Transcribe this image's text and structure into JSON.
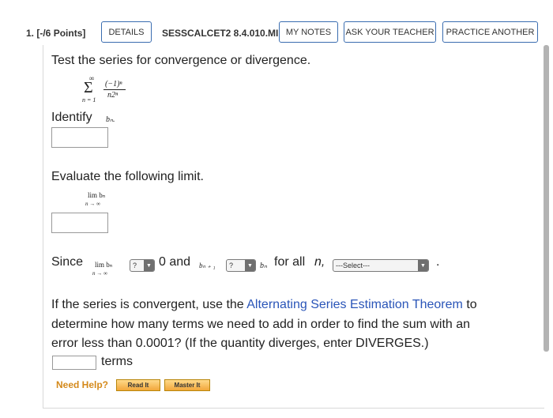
{
  "header": {
    "question_number": "1.",
    "points": "[-/6 Points]",
    "details_label": "DETAILS",
    "question_id": "SESSCALCET2 8.4.010.MI.",
    "my_notes_label": "MY NOTES",
    "ask_teacher_label": "ASK YOUR TEACHER",
    "practice_another_label": "PRACTICE ANOTHER"
  },
  "problem": {
    "prompt": "Test the series for convergence or divergence.",
    "series": {
      "upper": "∞",
      "sigma": "Σ",
      "numerator": "(−1)ⁿ",
      "denominator": "n2ⁿ",
      "lower": "n = 1"
    },
    "identify_label": "Identify",
    "identify_math": "bₙ.",
    "evaluate_label": "Evaluate the following limit.",
    "limit_top": "lim  bₙ",
    "limit_bottom": "n → ∞"
  },
  "since_line": {
    "since": "Since",
    "lim_top": "lim  bₙ",
    "lim_bottom": "n → ∞",
    "select1_value": "?",
    "zero_and": "0 and",
    "b_next": "bₙ ₊ ₁",
    "select2_value": "?",
    "b_n": "bₙ",
    "for_all": "for all",
    "n_var": "n,",
    "select3_value": "---Select---",
    "period": "."
  },
  "estimation": {
    "text_before": "If the series is convergent, use the",
    "link_text": "Alternating Series Estimation Theorem",
    "text_after": "to",
    "line2": "determine how many terms we need to add in order to find the sum with an",
    "line3": "error less than 0.0001? (If the quantity diverges, enter DIVERGES.)",
    "terms_label": "terms"
  },
  "help": {
    "need_help": "Need Help?",
    "read_it": "Read It",
    "master_it": "Master It"
  }
}
